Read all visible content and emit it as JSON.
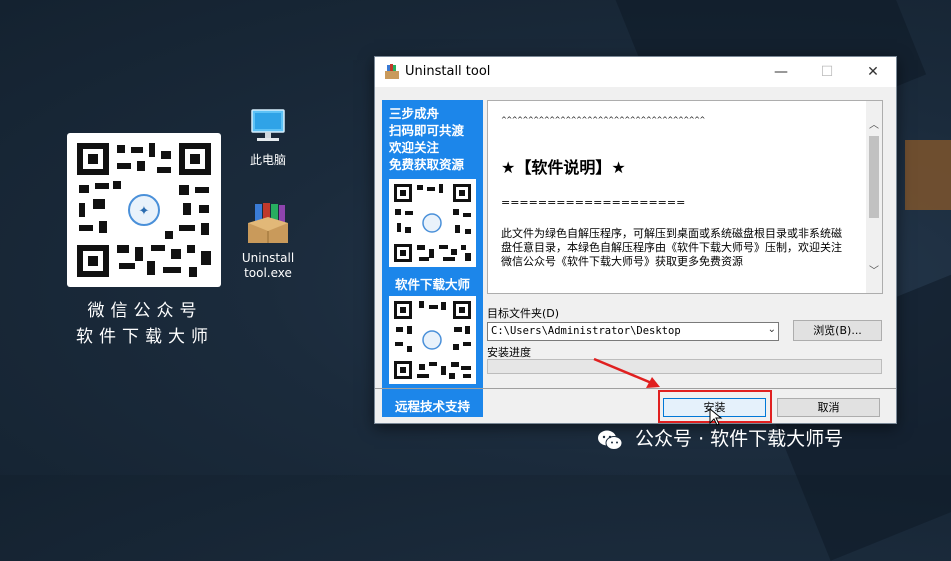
{
  "desktop": {
    "qr_caption_line1": "微信公众号",
    "qr_caption_line2": "软件下载大师",
    "icons": [
      {
        "label_line1": "此电脑",
        "label_line2": "",
        "icon": "computer-icon"
      },
      {
        "label_line1": "Uninstall",
        "label_line2": "tool.exe",
        "icon": "archive-box-icon"
      }
    ]
  },
  "window": {
    "title": "Uninstall tool",
    "controls": {
      "minimize": "—",
      "maximize": "☐",
      "close": "✕"
    },
    "sidebar": {
      "promo_lines": [
        "三步成舟",
        "扫码即可共渡",
        "欢迎关注",
        "免费获取资源"
      ],
      "mid_label": "软件下载大师",
      "bottom_label": "远程技术支持"
    },
    "info": {
      "line_carets": "^^^^^^^^^^^^^^^^^^^^^^^^^^^^^^^^^^^^^^",
      "heading": "★【软件说明】★",
      "line_equals": "====================",
      "paragraph": "此文件为绿色自解压程序，可解压到桌面或系统磁盘根目录或非系统磁盘任意目录，本绿色自解压程序由《软件下载大师号》压制，欢迎关注微信公众号《软件下载大师号》获取更多免费资源"
    },
    "target_folder_label": "目标文件夹(D)",
    "target_folder_value": "C:\\Users\\Administrator\\Desktop",
    "browse_label": "浏览(B)...",
    "progress_label": "安装进度",
    "progress": 0,
    "install_label": "安装",
    "cancel_label": "取消"
  },
  "watermark": "公众号 · 软件下载大师号",
  "colors": {
    "accent": "#1c86ea",
    "highlight": "#e02020",
    "install_focus": "#0078d7"
  }
}
